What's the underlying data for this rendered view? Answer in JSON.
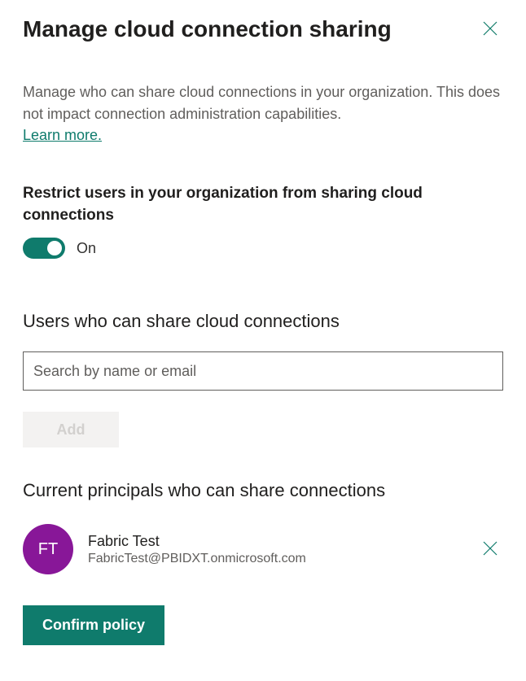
{
  "header": {
    "title": "Manage cloud connection sharing"
  },
  "description": "Manage who can share cloud connections in your organization. This does not impact connection administration capabilities.",
  "learn_more_label": "Learn more.",
  "restrict": {
    "label": "Restrict users in your organization from sharing cloud connections",
    "toggle_state": "On"
  },
  "users_section": {
    "heading": "Users who can share cloud connections",
    "search_placeholder": "Search by name or email",
    "add_label": "Add"
  },
  "principals_section": {
    "heading": "Current principals who can share connections",
    "items": [
      {
        "initials": "FT",
        "name": "Fabric Test",
        "email": "FabricTest@PBIDXT.onmicrosoft.com"
      }
    ]
  },
  "confirm_label": "Confirm policy"
}
